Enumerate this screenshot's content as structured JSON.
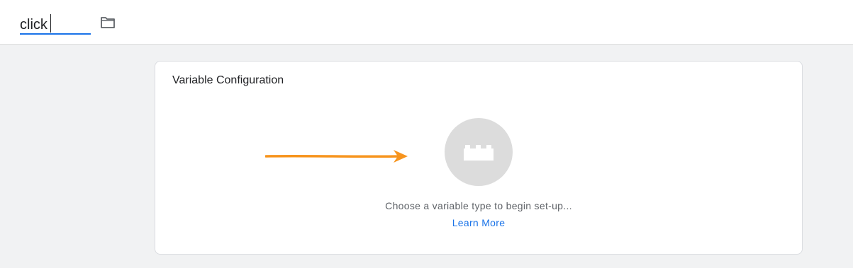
{
  "header": {
    "name_value": "click",
    "folder_icon": "folder-icon"
  },
  "card": {
    "title": "Variable Configuration",
    "picker_icon": "lego-block-icon",
    "hint": "Choose a variable type to begin set-up...",
    "learn_more": "Learn More"
  },
  "colors": {
    "accent": "#1a73e8",
    "annotation_arrow": "#f7941d",
    "picker_bg": "#dcdcdc"
  }
}
